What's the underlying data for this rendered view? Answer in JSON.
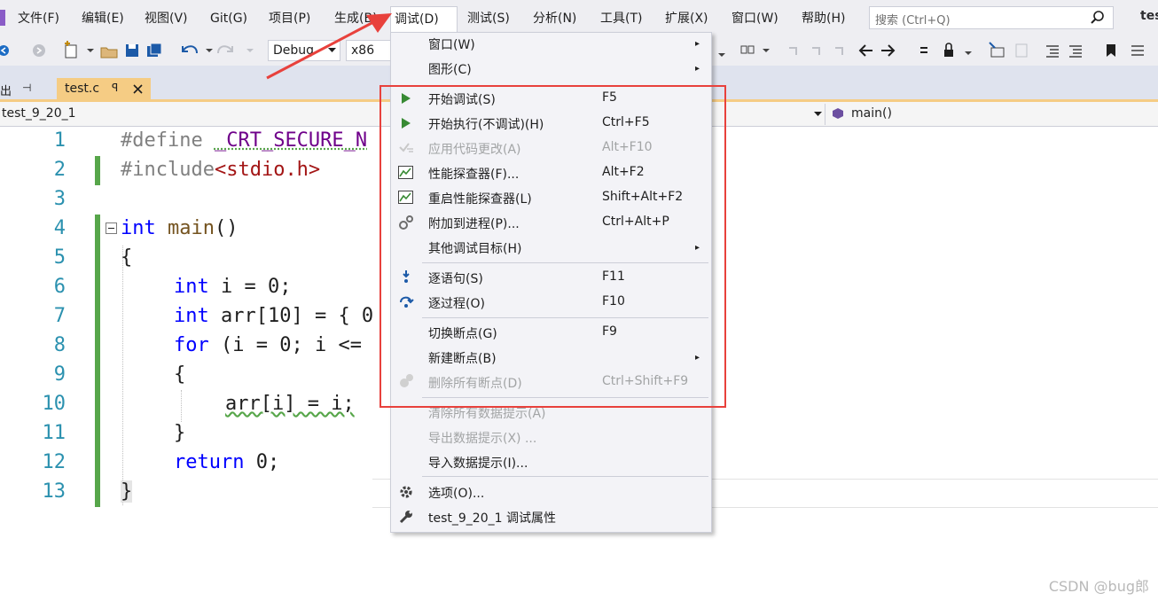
{
  "menubar": {
    "items": [
      {
        "label": "文件(F)"
      },
      {
        "label": "编辑(E)"
      },
      {
        "label": "视图(V)"
      },
      {
        "label": "Git(G)"
      },
      {
        "label": "项目(P)"
      },
      {
        "label": "生成(B)"
      },
      {
        "label": "调试(D)"
      },
      {
        "label": "测试(S)"
      },
      {
        "label": "分析(N)"
      },
      {
        "label": "工具(T)"
      },
      {
        "label": "扩展(X)"
      },
      {
        "label": "窗口(W)"
      },
      {
        "label": "帮助(H)"
      }
    ],
    "search_placeholder": "搜索 (Ctrl+Q)",
    "right_badge": "tes"
  },
  "toolbar": {
    "config": "Debug",
    "platform": "x86"
  },
  "tabs": {
    "left_fragment": "出",
    "pin_glyph": "ꟼ",
    "active": "test.c"
  },
  "navbar": {
    "project": "test_9_20_1",
    "scope": "main()"
  },
  "editor": {
    "line_numbers": [
      "1",
      "2",
      "3",
      "4",
      "5",
      "6",
      "7",
      "8",
      "9",
      "10",
      "11",
      "12",
      "13"
    ],
    "lines": {
      "l1_a": "#define ",
      "l1_b": "_CRT_SECURE_N",
      "l2_a": "#include",
      "l2_b": "<stdio.h>",
      "l4_a": "int",
      "l4_b": " main",
      "l4_c": "()",
      "l5": "{",
      "l6_a": "int",
      "l6_b": " i = 0;",
      "l7_a": "int",
      "l7_b": " arr[10] = { 0",
      "l8_a": "for",
      "l8_b": " (i = 0; i <=",
      "l9": "{",
      "l10": "arr[i] = i;",
      "l11": "}",
      "l12_a": "return",
      "l12_b": " 0;",
      "l13": "}"
    }
  },
  "dropdown": {
    "items": [
      {
        "label": "窗口(W)",
        "shortcut": ""
      },
      {
        "label": "图形(C)",
        "shortcut": ""
      },
      {
        "label": "开始调试(S)",
        "shortcut": "F5"
      },
      {
        "label": "开始执行(不调试)(H)",
        "shortcut": "Ctrl+F5"
      },
      {
        "label": "应用代码更改(A)",
        "shortcut": "Alt+F10"
      },
      {
        "label": "性能探查器(F)...",
        "shortcut": "Alt+F2"
      },
      {
        "label": "重启性能探查器(L)",
        "shortcut": "Shift+Alt+F2"
      },
      {
        "label": "附加到进程(P)...",
        "shortcut": "Ctrl+Alt+P"
      },
      {
        "label": "其他调试目标(H)",
        "shortcut": ""
      },
      {
        "label": "逐语句(S)",
        "shortcut": "F11"
      },
      {
        "label": "逐过程(O)",
        "shortcut": "F10"
      },
      {
        "label": "切换断点(G)",
        "shortcut": "F9"
      },
      {
        "label": "新建断点(B)",
        "shortcut": ""
      },
      {
        "label": "删除所有断点(D)",
        "shortcut": "Ctrl+Shift+F9"
      },
      {
        "label": "清除所有数据提示(A)",
        "shortcut": ""
      },
      {
        "label": "导出数据提示(X) ...",
        "shortcut": ""
      },
      {
        "label": "导入数据提示(I)...",
        "shortcut": ""
      },
      {
        "label": "选项(O)...",
        "shortcut": ""
      },
      {
        "label": "test_9_20_1 调试属性",
        "shortcut": ""
      }
    ],
    "submenu_arrow": "▸"
  },
  "watermark": "CSDN @bug郎",
  "colors": {
    "highlight_box": "#e8413c",
    "arrow": "#e8413c",
    "menubar_bg": "#eeeef2",
    "keyword": "#0000ff",
    "line_number": "#2b91af"
  }
}
